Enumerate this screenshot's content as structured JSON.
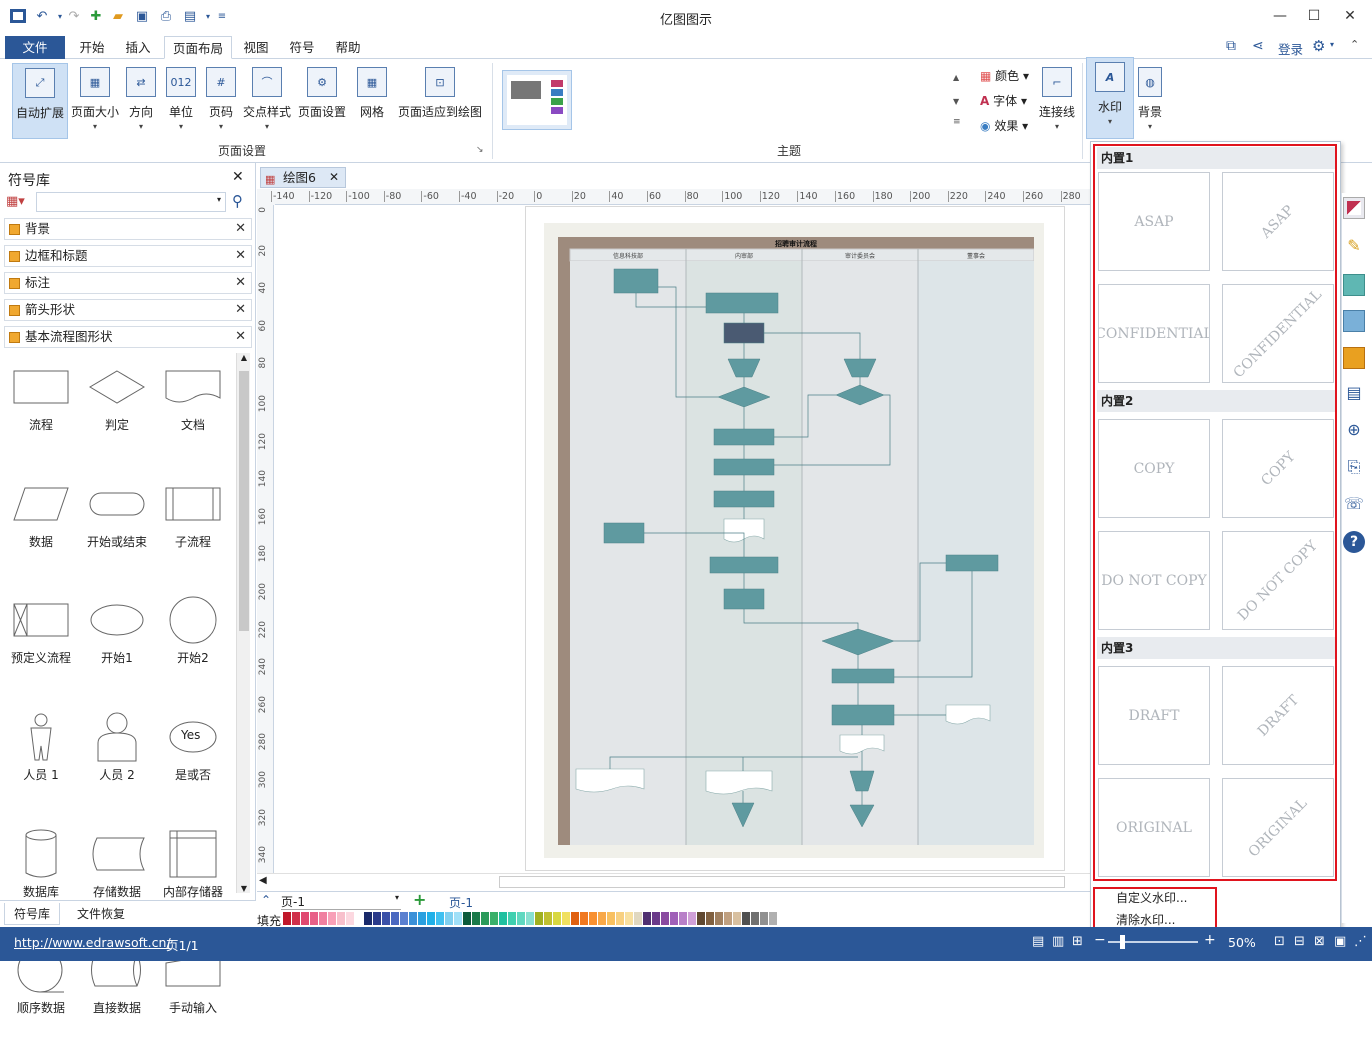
{
  "app": {
    "title": "亿图图示"
  },
  "menu_tabs": [
    "文件",
    "开始",
    "插入",
    "页面布局",
    "视图",
    "符号",
    "帮助"
  ],
  "active_tab": "页面布局",
  "account": {
    "login": "登录"
  },
  "ribbon": {
    "page_setup": {
      "group_label": "页面设置",
      "buttons": [
        "自动扩展",
        "页面大小",
        "方向",
        "单位",
        "页码",
        "交点样式",
        "页面设置",
        "网格",
        "页面适应到绘图"
      ]
    },
    "theme": {
      "group_label": "主题",
      "color": "颜色",
      "font": "字体",
      "effect": "效果",
      "connector": "连接线"
    },
    "watermark": "水印",
    "background": "背景"
  },
  "library": {
    "title": "符号库",
    "categories": [
      "背景",
      "边框和标题",
      "标注",
      "箭头形状",
      "基本流程图形状"
    ],
    "shapes": [
      "流程",
      "判定",
      "文档",
      "数据",
      "开始或结束",
      "子流程",
      "预定义流程",
      "开始1",
      "开始2",
      "人员 1",
      "人员 2",
      "是或否",
      "数据库",
      "存储数据",
      "内部存储器",
      "顺序数据",
      "直接数据",
      "手动输入"
    ],
    "yes_label": "Yes",
    "bottom_tabs": [
      "符号库",
      "文件恢复"
    ]
  },
  "document": {
    "tab": "绘图6",
    "ruler_h": [
      "-140",
      "-120",
      "-100",
      "-80",
      "-60",
      "-40",
      "-20",
      "0",
      "20",
      "40",
      "60",
      "80",
      "100",
      "120",
      "140",
      "160",
      "180",
      "200",
      "220",
      "240",
      "260",
      "280"
    ],
    "ruler_v": [
      "0",
      "20",
      "40",
      "60",
      "80",
      "100",
      "120",
      "140",
      "160",
      "180",
      "200",
      "220",
      "240",
      "260",
      "280",
      "300",
      "320",
      "340"
    ],
    "diagram_title": "招聘审计流程",
    "lanes": [
      "信息科技部",
      "内审部",
      "审计委员会",
      "董事会"
    ]
  },
  "watermark_menu": {
    "sections": [
      {
        "label": "内置1",
        "items": [
          "ASAP",
          "ASAP",
          "CONFIDENTIAL",
          "CONFIDENTIAL"
        ]
      },
      {
        "label": "内置2",
        "items": [
          "COPY",
          "COPY",
          "DO NOT COPY",
          "DO NOT COPY"
        ]
      },
      {
        "label": "内置3",
        "items": [
          "DRAFT",
          "DRAFT",
          "ORIGINAL",
          "ORIGINAL"
        ]
      }
    ],
    "custom": "自定义水印...",
    "clear": "清除水印..."
  },
  "pagebar": {
    "page_select": "页-1",
    "page_tab": "页-1"
  },
  "colorbar": {
    "label": "填充"
  },
  "status": {
    "url": "http://www.edrawsoft.cn/",
    "page": "页1/1",
    "zoom": "50%"
  },
  "colors": {
    "accent": "#2b5797",
    "highlight": "#e0141e"
  }
}
